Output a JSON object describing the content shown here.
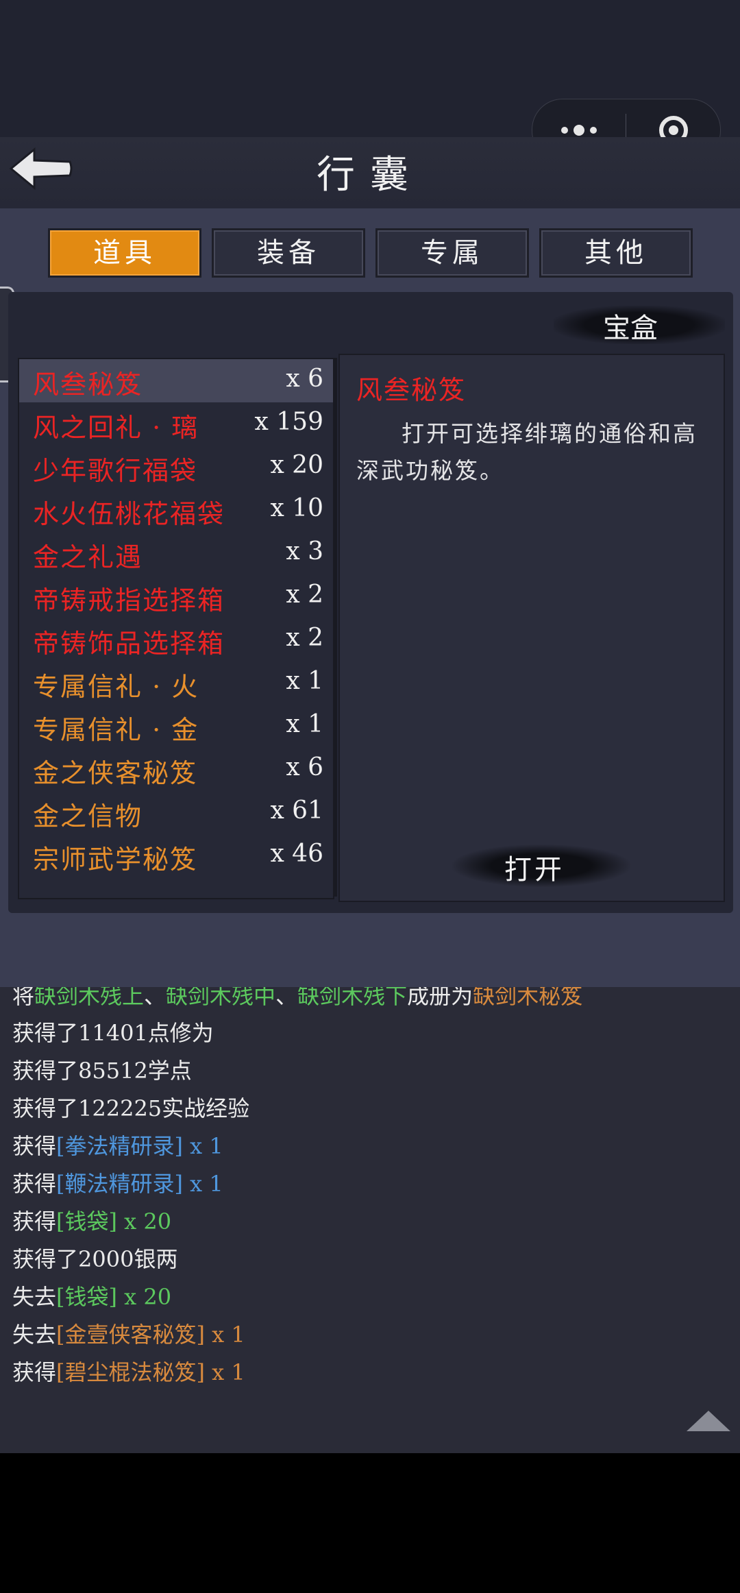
{
  "header": {
    "title": "行囊"
  },
  "tabs": [
    {
      "label": "道具",
      "active": true
    },
    {
      "label": "装备",
      "active": false
    },
    {
      "label": "专属",
      "active": false
    },
    {
      "label": "其他",
      "active": false
    }
  ],
  "box_label": "宝盒",
  "items": [
    {
      "name": "风叁秘笈",
      "qty": "x 6",
      "color": "#ea2424",
      "selected": true
    },
    {
      "name": "风之回礼 · 璃",
      "qty": "x 159",
      "color": "#ea2424"
    },
    {
      "name": "少年歌行福袋",
      "qty": "x 20",
      "color": "#ea2424"
    },
    {
      "name": "水火伍桃花福袋",
      "qty": "x 10",
      "color": "#ea2424"
    },
    {
      "name": "金之礼遇",
      "qty": "x 3",
      "color": "#ea2424"
    },
    {
      "name": "帝铸戒指选择箱",
      "qty": "x 2",
      "color": "#ea2424"
    },
    {
      "name": "帝铸饰品选择箱",
      "qty": "x 2",
      "color": "#ea2424"
    },
    {
      "name": "专属信礼 · 火",
      "qty": "x 1",
      "color": "#e8902c"
    },
    {
      "name": "专属信礼 · 金",
      "qty": "x 1",
      "color": "#e8902c"
    },
    {
      "name": "金之侠客秘笈",
      "qty": "x 6",
      "color": "#e8902c"
    },
    {
      "name": "金之信物",
      "qty": "x 61",
      "color": "#e8902c"
    },
    {
      "name": "宗师武学秘笈",
      "qty": "x 46",
      "color": "#e8902c"
    }
  ],
  "detail": {
    "title": "风叁秘笈",
    "description": "打开可选择绯璃的通俗和高深武功秘笈。",
    "open_label": "打开"
  },
  "log": {
    "partial_line": {
      "p1": "将",
      "p2": "缺剑木残上",
      "p3": "、",
      "p4": "缺剑木残中",
      "p5": "、",
      "p6": "缺剑木残下",
      "p7": "成册为",
      "p8": "缺剑木秘笈"
    },
    "lines": [
      {
        "prefix": "获得了11401点修为",
        "item": "",
        "suffix": "",
        "color": ""
      },
      {
        "prefix": "获得了85512学点",
        "item": "",
        "suffix": "",
        "color": ""
      },
      {
        "prefix": "获得了122225实战经验",
        "item": "",
        "suffix": "",
        "color": ""
      },
      {
        "prefix": "获得",
        "item": "[拳法精研录]",
        "suffix": " x 1",
        "color": "#4f97de"
      },
      {
        "prefix": "获得",
        "item": "[鞭法精研录]",
        "suffix": " x 1",
        "color": "#4f97de"
      },
      {
        "prefix": "获得",
        "item": "[钱袋]",
        "suffix": " x 20",
        "color": "#5cc95e"
      },
      {
        "prefix": "获得了2000银两",
        "item": "",
        "suffix": "",
        "color": ""
      },
      {
        "prefix": "失去",
        "item": "[钱袋]",
        "suffix": " x 20",
        "color": "#5cc95e"
      },
      {
        "prefix": "失去",
        "item": "[金壹侠客秘笈]",
        "suffix": " x 1",
        "color": "#d88a3e"
      },
      {
        "prefix": "获得",
        "item": "[碧尘棍法秘笈]",
        "suffix": " x 1",
        "color": "#d88a3e"
      }
    ]
  }
}
